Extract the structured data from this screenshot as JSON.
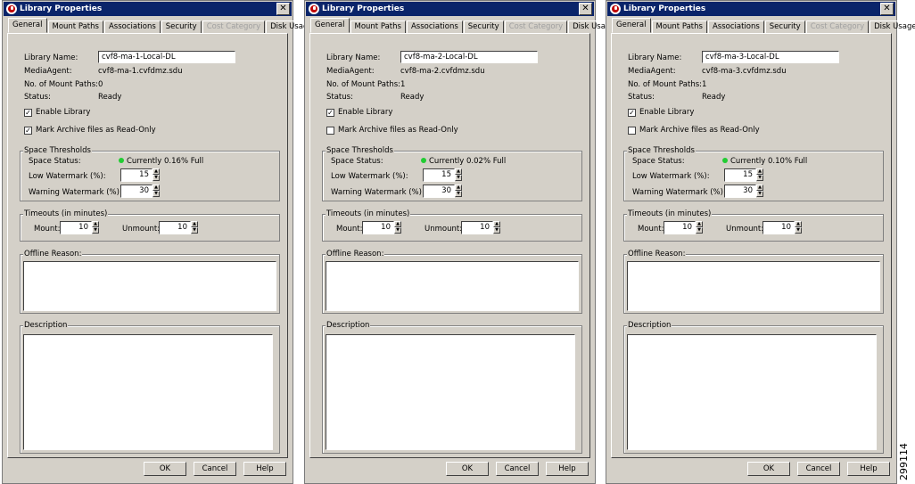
{
  "figure_id": "299114",
  "dialogs": [
    {
      "title": "Library Properties",
      "tabs": [
        "General",
        "Mount Paths",
        "Associations",
        "Security",
        "Cost Category",
        "Disk Usage"
      ],
      "library_name_label": "Library Name:",
      "library_name_value": "cvf8-ma-1-Local-DL",
      "media_agent_label": "MediaAgent:",
      "media_agent_value": "cvf8-ma-1.cvfdmz.sdu",
      "mount_paths_label": "No. of Mount Paths:",
      "mount_paths_value": "0",
      "status_label": "Status:",
      "status_value": "Ready",
      "enable_library_label": "Enable Library",
      "mark_archive_label": "Mark Archive files as Read-Only",
      "space_thresholds_title": "Space Thresholds",
      "space_status_label": "Space Status:",
      "space_status_value": "Currently 0.16% Full",
      "low_watermark_label": "Low Watermark (%):",
      "low_watermark_value": "15",
      "warning_watermark_label": "Warning Watermark (%):",
      "warning_watermark_value": "30",
      "timeouts_title": "Timeouts (in minutes)",
      "mount_label": "Mount:",
      "mount_value": "10",
      "unmount_label": "Unmount:",
      "unmount_value": "10",
      "offline_reason_title": "Offline Reason:",
      "description_title": "Description",
      "ok_label": "OK",
      "cancel_label": "Cancel",
      "help_label": "Help"
    },
    {
      "title": "Library Properties",
      "tabs": [
        "General",
        "Mount Paths",
        "Associations",
        "Security",
        "Cost Category",
        "Disk Usage"
      ],
      "library_name_label": "Library Name:",
      "library_name_value": "cvf8-ma-2-Local-DL",
      "media_agent_label": "MediaAgent:",
      "media_agent_value": "cvf8-ma-2.cvfdmz.sdu",
      "mount_paths_label": "No. of Mount Paths:",
      "mount_paths_value": "1",
      "status_label": "Status:",
      "status_value": "Ready",
      "enable_library_label": "Enable Library",
      "mark_archive_label": "Mark Archive files as Read-Only",
      "space_thresholds_title": "Space Thresholds",
      "space_status_label": "Space Status:",
      "space_status_value": "Currently 0.02% Full",
      "low_watermark_label": "Low Watermark (%):",
      "low_watermark_value": "15",
      "warning_watermark_label": "Warning Watermark (%):",
      "warning_watermark_value": "30",
      "timeouts_title": "Timeouts (in minutes)",
      "mount_label": "Mount:",
      "mount_value": "10",
      "unmount_label": "Unmount:",
      "unmount_value": "10",
      "offline_reason_title": "Offline Reason:",
      "description_title": "Description",
      "ok_label": "OK",
      "cancel_label": "Cancel",
      "help_label": "Help"
    },
    {
      "title": "Library Properties",
      "tabs": [
        "General",
        "Mount Paths",
        "Associations",
        "Security",
        "Cost Category",
        "Disk Usage"
      ],
      "library_name_label": "Library Name:",
      "library_name_value": "cvf8-ma-3-Local-DL",
      "media_agent_label": "MediaAgent:",
      "media_agent_value": "cvf8-ma-3.cvfdmz.sdu",
      "mount_paths_label": "No. of Mount Paths:",
      "mount_paths_value": "1",
      "status_label": "Status:",
      "status_value": "Ready",
      "enable_library_label": "Enable Library",
      "mark_archive_label": "Mark Archive files as Read-Only",
      "space_thresholds_title": "Space Thresholds",
      "space_status_label": "Space Status:",
      "space_status_value": "Currently 0.10% Full",
      "low_watermark_label": "Low Watermark (%):",
      "low_watermark_value": "15",
      "warning_watermark_label": "Warning Watermark (%):",
      "warning_watermark_value": "30",
      "timeouts_title": "Timeouts (in minutes)",
      "mount_label": "Mount:",
      "mount_value": "10",
      "unmount_label": "Unmount:",
      "unmount_value": "10",
      "offline_reason_title": "Offline Reason:",
      "description_title": "Description",
      "ok_label": "OK",
      "cancel_label": "Cancel",
      "help_label": "Help"
    }
  ],
  "checkbox_states": [
    {
      "enable_library": true,
      "mark_archive": true
    },
    {
      "enable_library": true,
      "mark_archive": false
    },
    {
      "enable_library": true,
      "mark_archive": false
    }
  ],
  "icons": {
    "app": "commvault-logo-icon",
    "close": "close-icon",
    "status": "status-green-dot-icon"
  },
  "colors": {
    "titlebar": "#0a246a",
    "dialog_bg": "#d4d0c8",
    "status_ok": "#22cc33"
  }
}
